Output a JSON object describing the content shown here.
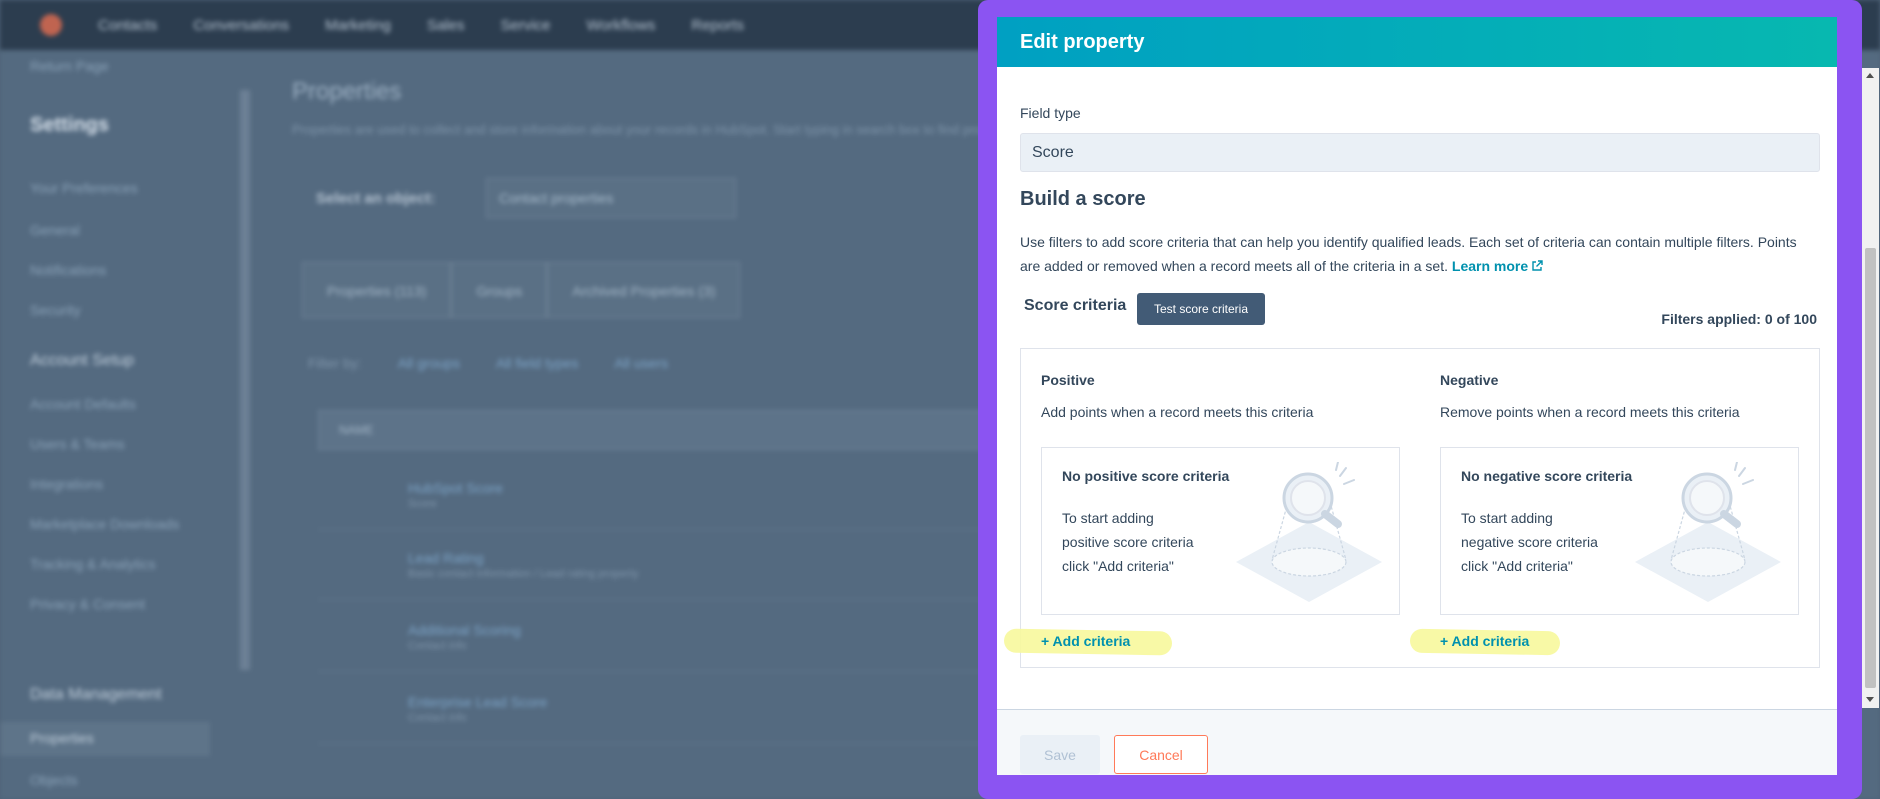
{
  "background": {
    "top_nav": [
      "Contacts",
      "Conversations",
      "Marketing",
      "Sales",
      "Service",
      "Workflows",
      "Reports"
    ],
    "sidebar": {
      "back_link": "Return Page",
      "title": "Settings",
      "items": [
        "Your Preferences",
        "General",
        "Notifications",
        "Security",
        "Account Setup",
        "Account Defaults",
        "Users & Teams",
        "Integrations",
        "Marketplace Downloads",
        "Tracking & Analytics",
        "Privacy & Consent",
        "Data Management",
        "Properties",
        "Objects"
      ]
    },
    "main": {
      "title": "Properties",
      "description": "Properties are used to collect and store information about your records in HubSpot. Start typing in search box to find properties.",
      "select_label": "Select an object:",
      "select_value": "Contact properties",
      "tabs": [
        "Properties (113)",
        "Groups",
        "Archived Properties (3)"
      ],
      "filter_prefix": "Filter by:",
      "filters": [
        "All groups",
        "All field types",
        "All users"
      ],
      "table_header": "NAME",
      "rows": [
        {
          "name": "HubSpot Score",
          "sub": "Score"
        },
        {
          "name": "Lead Rating",
          "sub": "Basic contact information / Lead rating property"
        },
        {
          "name": "Additional Scoring",
          "sub": "Contact info"
        },
        {
          "name": "Enterprise Lead Score",
          "sub": "Contact info"
        }
      ]
    }
  },
  "panel": {
    "title": "Edit property",
    "field_type_label": "Field type",
    "field_type_value": "Score",
    "section_title": "Build a score",
    "section_desc": "Use filters to add score criteria that can help you identify qualified leads. Each set of criteria can contain multiple filters. Points are added or removed when a record meets all of the criteria in a set.",
    "learn_more": "Learn more",
    "criteria_label": "Score criteria",
    "test_button": "Test score criteria",
    "filters_applied": "Filters applied: 0 of 100",
    "positive": {
      "title": "Positive",
      "desc": "Add points when a record meets this criteria",
      "empty_title": "No positive score criteria",
      "empty_text": "To start adding positive score criteria click \"Add criteria\"",
      "add_link": "+ Add criteria"
    },
    "negative": {
      "title": "Negative",
      "desc": "Remove points when a record meets this criteria",
      "empty_title": "No negative score criteria",
      "empty_text": "To start adding negative score criteria click \"Add criteria\"",
      "add_link": "+ Add criteria"
    },
    "save_button": "Save",
    "cancel_button": "Cancel"
  },
  "colors": {
    "frame": "#8b54f2",
    "header_start": "#00a0c2",
    "header_end": "#07b8b0",
    "link": "#0091ae",
    "highlight": "#f7f89c",
    "cancel": "#ff7a59",
    "test_button": "#425b76"
  }
}
